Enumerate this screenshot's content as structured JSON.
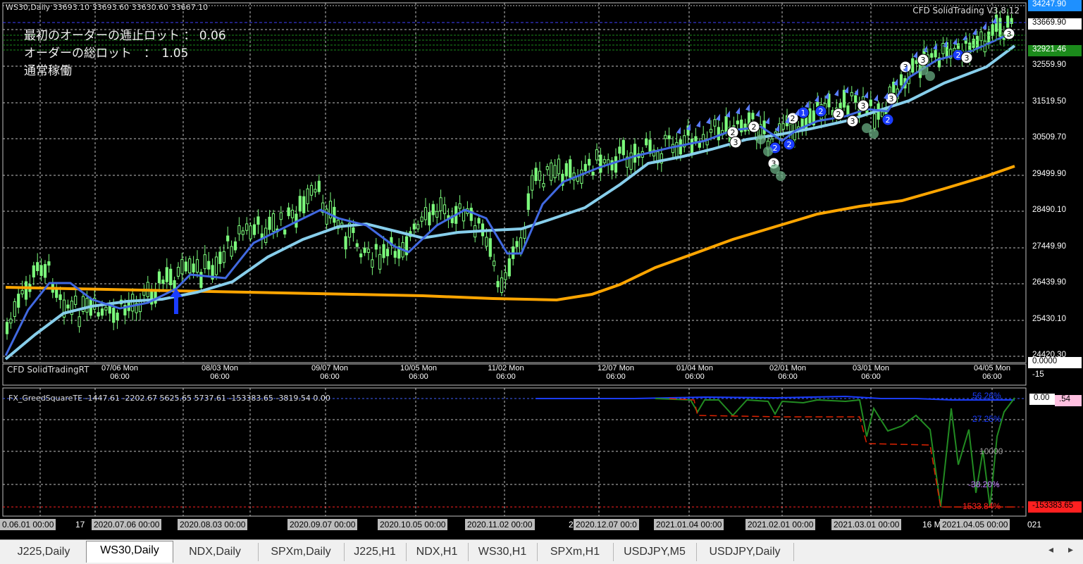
{
  "chart_header": {
    "ohlc_line": "WS30,Daily 33693.10 33693.60 33630.60 33667.10",
    "ea_name": "CFD SolidTrading V3.8.12",
    "first_order_lot": "最初のオーダーの逓止ロット ： 0.06",
    "total_lot": "オーダーの総ロット　：　1.05",
    "status": "通常稼働"
  },
  "price_axis": [
    "34247.90",
    "33669.90",
    "32921.46",
    "32559.90",
    "31519.50",
    "30509.70",
    "29499.90",
    "28490.10",
    "27449.90",
    "26439.90",
    "25430.10",
    "24420.30"
  ],
  "price_axis_highlight": {
    "top": "34247.90",
    "current": "33669.90",
    "line": "32921.46"
  },
  "indicator1": {
    "name": "CFD SolidTradingRT",
    "axis_value": "0.0000",
    "axis_value2": "-15"
  },
  "time_labels": [
    {
      "date": "07/06 Mon",
      "time": "06:00"
    },
    {
      "date": "08/03 Mon",
      "time": "06:00"
    },
    {
      "date": "09/07 Mon",
      "time": "06:00"
    },
    {
      "date": "10/05 Mon",
      "time": "06:00"
    },
    {
      "date": "11/02 Mon",
      "time": "06:00"
    },
    {
      "date": "12/07 Mon",
      "time": "06:00"
    },
    {
      "date": "01/04 Mon",
      "time": "06:00"
    },
    {
      "date": "02/01 Mon",
      "time": "06:00"
    },
    {
      "date": "03/01 Mon",
      "time": "06:00"
    },
    {
      "date": "04/05 Mon",
      "time": "06:00"
    }
  ],
  "indicator2": {
    "label": "FX_GreedSquareTE -1447.61 -2202.67 5625.65 5737.61 -153383.65 -3819.54 0.00",
    "pct_top": "56.26%",
    "pct_blue": "27.25%",
    "value_1000": "10000",
    "pct_purple": "-38.20%",
    "pct_red": "-1533.84%",
    "axis_top": "0.00",
    "axis_top2": ".54",
    "axis_bottom": "-153383.65"
  },
  "bottom_time_axis": [
    "0.06.01 00:00",
    "17",
    "2020.07.06 00:00",
    "2020.08.03 00:00",
    "2020.09.07 00:00",
    "2020.10.05 00:00",
    "2020.11.02 00:00",
    "2",
    "2020.12.07 00:0",
    "2021.01.04 00:00",
    "2021.02.01 00:00",
    "2021.03.01 00:00",
    "16 M",
    "2021.04.05 00:00",
    "021"
  ],
  "tabs": [
    {
      "label": "J225,Daily",
      "active": false
    },
    {
      "label": "WS30,Daily",
      "active": true
    },
    {
      "label": "NDX,Daily",
      "active": false
    },
    {
      "label": "SPXm,Daily",
      "active": false
    },
    {
      "label": "J225,H1",
      "active": false
    },
    {
      "label": "NDX,H1",
      "active": false
    },
    {
      "label": "WS30,H1",
      "active": false
    },
    {
      "label": "SPXm,H1",
      "active": false
    },
    {
      "label": "USDJPY,M5",
      "active": false
    },
    {
      "label": "USDJPY,Daily",
      "active": false
    }
  ],
  "colors": {
    "background": "#000000",
    "grid": "#c0c0c0",
    "candle": "#7cfc7c",
    "ma_fast": "#4169e1",
    "ma_mid": "#87ceeb",
    "ma_slow": "#ffa500",
    "equity": "#228b22",
    "drawdown": "#dd2200"
  },
  "icons": {
    "buy_arrow": "arrow-up-icon",
    "scroll_left": "chevron-left-icon",
    "scroll_right": "chevron-right-icon"
  }
}
